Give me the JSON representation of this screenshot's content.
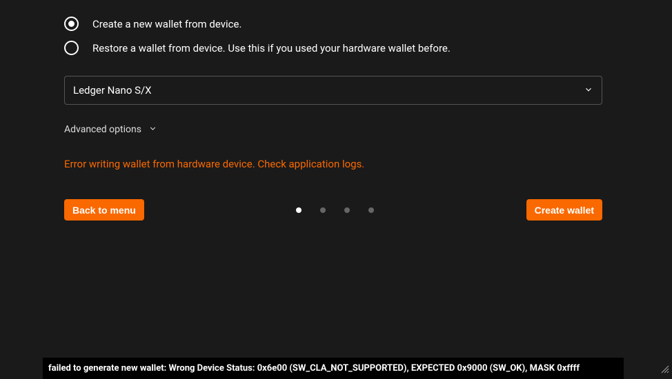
{
  "radios": {
    "create_label": "Create a new wallet from device.",
    "restore_label": "Restore a wallet from device. Use this if you used your hardware wallet before.",
    "selected": "create"
  },
  "device_select": {
    "value": "Ledger Nano S/X"
  },
  "advanced": {
    "label": "Advanced options"
  },
  "error_message": "Error writing wallet from hardware device. Check application logs.",
  "buttons": {
    "back_label": "Back to menu",
    "create_label": "Create wallet"
  },
  "pagination": {
    "count": 4,
    "active": 0
  },
  "status": {
    "text": "failed to generate new wallet: Wrong Device Status: 0x6e00 (SW_CLA_NOT_SUPPORTED), EXPECTED 0x9000 (SW_OK), MASK 0xffff"
  }
}
